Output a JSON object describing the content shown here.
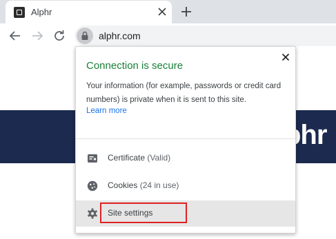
{
  "tab": {
    "title": "Alphr",
    "close_icon": "close-icon",
    "favicon": "alphr-favicon"
  },
  "toolbar": {
    "url": "alphr.com",
    "back_icon": "arrow-left-icon",
    "forward_icon": "arrow-right-icon",
    "reload_icon": "reload-icon",
    "lock_icon": "lock-icon"
  },
  "page": {
    "banner_logo": "phr",
    "banner_color": "#1b2a4e"
  },
  "popup": {
    "title": "Connection is secure",
    "title_color": "#188038",
    "description": "Your information (for example, passwords or credit card numbers) is private when it is sent to this site.",
    "learn_more": "Learn more",
    "items": [
      {
        "label": "Certificate",
        "sub": " (Valid)",
        "icon": "certificate-icon"
      },
      {
        "label": "Cookies",
        "sub": " (24 in use)",
        "icon": "cookie-icon"
      },
      {
        "label": "Site settings",
        "sub": "",
        "icon": "gear-icon"
      }
    ],
    "highlight_color": "#e02020"
  }
}
